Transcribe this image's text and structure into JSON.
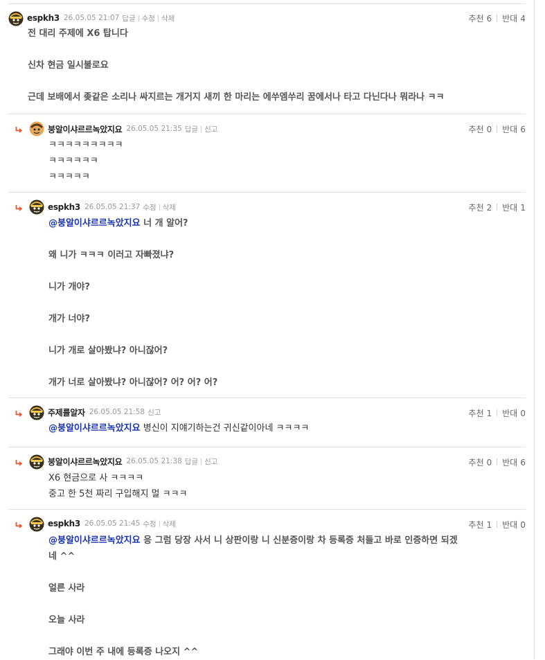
{
  "comments": [
    {
      "nick": "espkh3",
      "date": "26.05.05 21:07",
      "actions": [
        "답글",
        "수정",
        "삭제"
      ],
      "recommend_label": "추천",
      "recommend_count": "6",
      "oppose_label": "반대",
      "oppose_count": "4",
      "lines": [
        "전 대리 주제에 X6 탑니다",
        "",
        "신차 현금 일시불로요",
        "",
        "근데 보배에서 좆같은 소리나 싸지르는 개거지 새끼 한 마리는 에쑤엠쑤리 꿈에서나 타고 다닌다나 뭐라나 ㅋㅋ"
      ]
    },
    {
      "nick": "붕알이샤르르녹았지요",
      "date": "26.05.05 21:35",
      "actions": [
        "답글",
        "신고"
      ],
      "recommend_label": "추천",
      "recommend_count": "0",
      "oppose_label": "반대",
      "oppose_count": "6",
      "lines": [
        "ㅋㅋㅋㅋㅋㅋㅋㅋㅋ",
        "ㅋㅋㅋㅋㅋㅋ",
        "ㅋㅋㅋㅋㅋ"
      ]
    },
    {
      "nick": "espkh3",
      "date": "26.05.05 21:37",
      "actions": [
        "수정",
        "삭제"
      ],
      "recommend_label": "추천",
      "recommend_count": "2",
      "oppose_label": "반대",
      "oppose_count": "1",
      "mention": "@붕알이샤르르녹았지요",
      "first_line_rest": " 너 개 알어?",
      "lines": [
        "",
        "왜 니가 ㅋㅋㅋ 이러고 자빠졌냐?",
        "",
        "니가 개야?",
        "",
        "개가 너야?",
        "",
        "니가 개로 살아봤냐? 아니잖어?",
        "",
        "개가 너로 살아봤냐? 아니잖어? 어? 어? 어?"
      ]
    },
    {
      "nick": "주제를알자",
      "date": "26.05.05 21:58",
      "actions": [
        "신고"
      ],
      "recommend_label": "추천",
      "recommend_count": "1",
      "oppose_label": "반대",
      "oppose_count": "0",
      "mention": "@붕알이샤르르녹았지요",
      "first_line_rest": " 병신이 지얘기하는건 귀신같이아네 ㅋㅋㅋㅋ"
    },
    {
      "nick": "붕알이샤르르녹았지요",
      "date": "26.05.05 21:38",
      "actions": [
        "답글",
        "신고"
      ],
      "recommend_label": "추천",
      "recommend_count": "0",
      "oppose_label": "반대",
      "oppose_count": "6",
      "lines": [
        "X6 현금으로 사 ㅋㅋㅋㅋ",
        "중고 한 5천 짜리 구입해지 멀 ㅋㅋㅋ"
      ]
    },
    {
      "nick": "espkh3",
      "date": "26.05.05 21:45",
      "actions": [
        "수정",
        "삭제"
      ],
      "recommend_label": "추천",
      "recommend_count": "1",
      "oppose_label": "반대",
      "oppose_count": "0",
      "mention": "@붕알이샤르르녹았지요",
      "first_line_rest": " 응 그럼 당장 사서 니 상판이랑 니 신분증이랑 차 등록증 처들고 바로 인증하면 되겠",
      "second_line": "네 ^^",
      "lines": [
        "",
        "얼른 사라",
        "",
        "오늘 사라",
        "",
        "그래야 이번 주 내에 등록증 나오지 ^^"
      ]
    }
  ]
}
